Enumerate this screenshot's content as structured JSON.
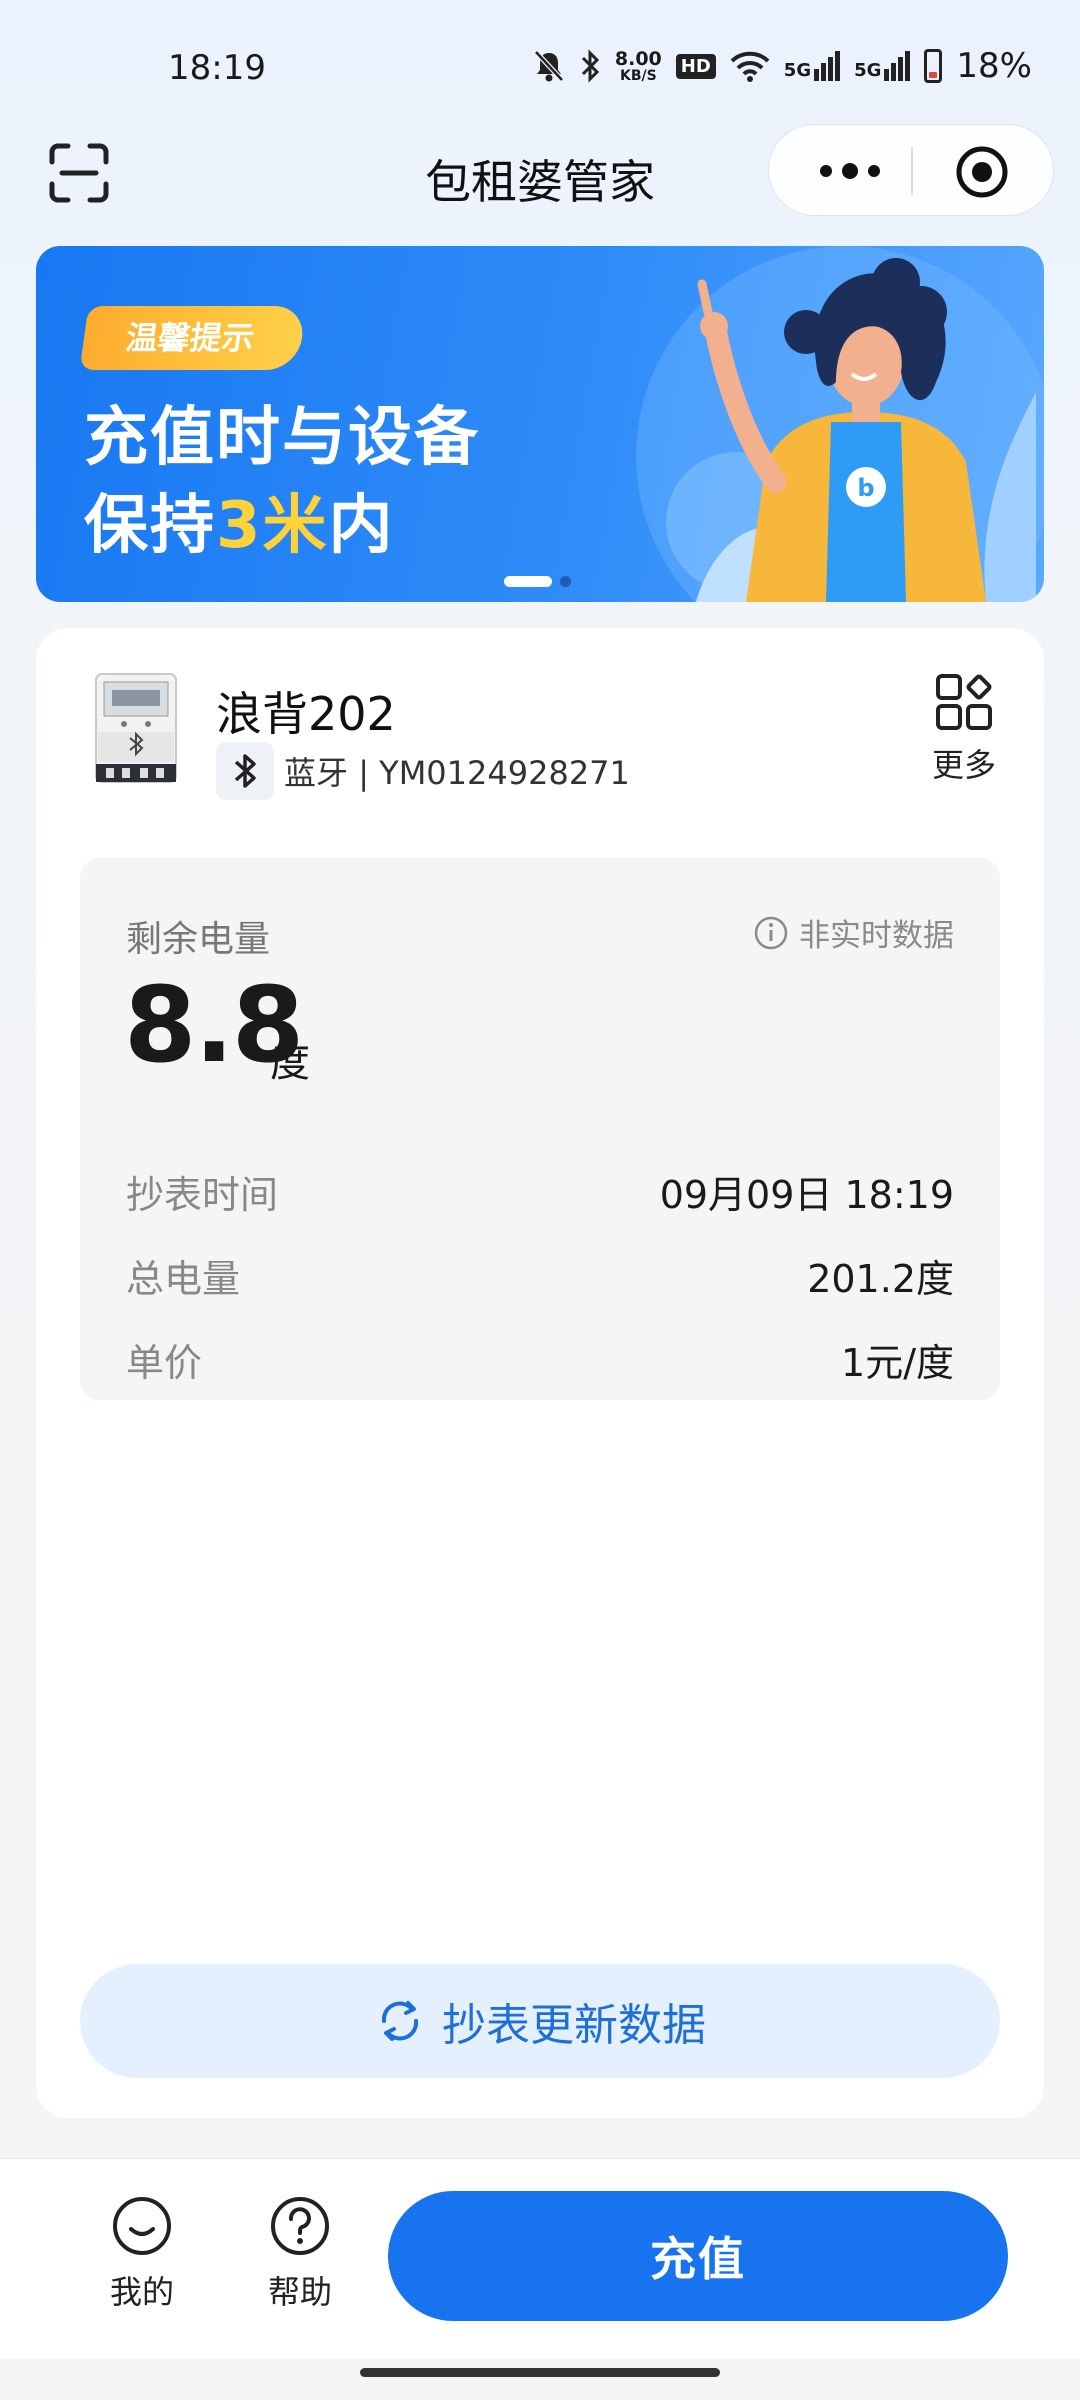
{
  "status_bar": {
    "time": "18:19",
    "net_speed_value": "8.00",
    "net_speed_unit": "KB/S",
    "hd_label": "HD",
    "signal1": "5G",
    "signal2": "5G",
    "battery": "18%",
    "icons": [
      "mute-bell-icon",
      "bluetooth-icon",
      "wifi-icon",
      "signal-icon",
      "battery-icon"
    ]
  },
  "header": {
    "title": "包租婆管家"
  },
  "banner": {
    "tag": "温馨提示",
    "line1": "充值时与设备",
    "line2_prefix": "保持",
    "line2_highlight": "3米",
    "line2_suffix": "内",
    "page_count": 2,
    "active_page": 1
  },
  "device": {
    "name": "浪背202",
    "connection": "蓝牙",
    "separator": "|",
    "id": "YM0124928271",
    "more_label": "更多"
  },
  "reading": {
    "remain_label": "剩余电量",
    "realtime_note": "非实时数据",
    "remain_value": "8.8",
    "remain_unit": "度",
    "rows": [
      {
        "label": "抄表时间",
        "value": "09月09日 18:19"
      },
      {
        "label": "总电量",
        "value": "201.2度"
      },
      {
        "label": "单价",
        "value": "1元/度"
      }
    ]
  },
  "actions": {
    "refresh_label": "抄表更新数据",
    "recharge_label": "充值"
  },
  "bottom_nav": [
    {
      "label": "我的",
      "icon": "smile-icon"
    },
    {
      "label": "帮助",
      "icon": "help-icon"
    }
  ],
  "colors": {
    "primary": "#1873ee",
    "accent_yellow": "#ffd23a",
    "refresh_bg": "#e4f0fd"
  }
}
